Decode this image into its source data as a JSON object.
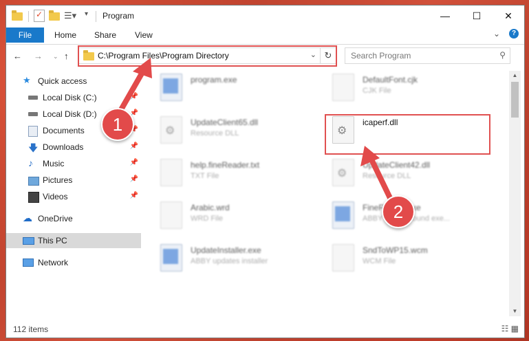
{
  "window": {
    "title": "Program"
  },
  "ribbon": {
    "tabs": [
      "File",
      "Home",
      "Share",
      "View"
    ]
  },
  "address": {
    "path": "C:\\Program Files\\Program Directory"
  },
  "search": {
    "placeholder": "Search Program"
  },
  "sidebar": {
    "items": [
      {
        "label": "Quick access",
        "icon": "star-icon",
        "pinned": false
      },
      {
        "label": "Local Disk (C:)",
        "icon": "drive-icon",
        "pinned": true
      },
      {
        "label": "Local Disk (D:)",
        "icon": "drive-icon",
        "pinned": true
      },
      {
        "label": "Documents",
        "icon": "documents-icon",
        "pinned": true
      },
      {
        "label": "Downloads",
        "icon": "download-arrow-icon",
        "pinned": true
      },
      {
        "label": "Music",
        "icon": "music-note-icon",
        "pinned": true
      },
      {
        "label": "Pictures",
        "icon": "pictures-icon",
        "pinned": true
      },
      {
        "label": "Videos",
        "icon": "film-icon",
        "pinned": true
      },
      {
        "label": "OneDrive",
        "icon": "cloud-icon",
        "pinned": false
      },
      {
        "label": "This PC",
        "icon": "monitor-icon",
        "pinned": false,
        "selected": true
      },
      {
        "label": "Network",
        "icon": "network-icon",
        "pinned": false
      }
    ]
  },
  "files": [
    {
      "name": "program.exe",
      "type": "",
      "icon": "application-icon"
    },
    {
      "name": "DefaultFont.cjk",
      "type": "CJK File",
      "icon": "document-icon"
    },
    {
      "name": "UpdateClient65.dll",
      "type": "Resource DLL",
      "icon": "gear-document-icon"
    },
    {
      "name": "icaperf.dll",
      "type": "",
      "icon": "gear-document-icon"
    },
    {
      "name": "help.fineReader.txt",
      "type": "TXT File",
      "icon": "document-icon"
    },
    {
      "name": "UpdateClient42.dll",
      "type": "Resource DLL",
      "icon": "gear-document-icon"
    },
    {
      "name": "Arabic.wrd",
      "type": "WRD File",
      "icon": "document-icon"
    },
    {
      "name": "FineReader.exe",
      "type": "ABBYY background exe...",
      "icon": "application-icon"
    },
    {
      "name": "UpdateInstaller.exe",
      "type": "ABBY updates installer",
      "icon": "application-icon"
    },
    {
      "name": "SndToWP15.wcm",
      "type": "WCM File",
      "icon": "document-icon"
    }
  ],
  "status": {
    "item_count": "112 items"
  },
  "annotations": [
    {
      "label": "1",
      "target": "address-bar"
    },
    {
      "label": "2",
      "target": "icaperf.dll"
    }
  ],
  "colors": {
    "accent": "#1979ca",
    "highlight": "#e05050",
    "badge": "#e24a4a"
  }
}
